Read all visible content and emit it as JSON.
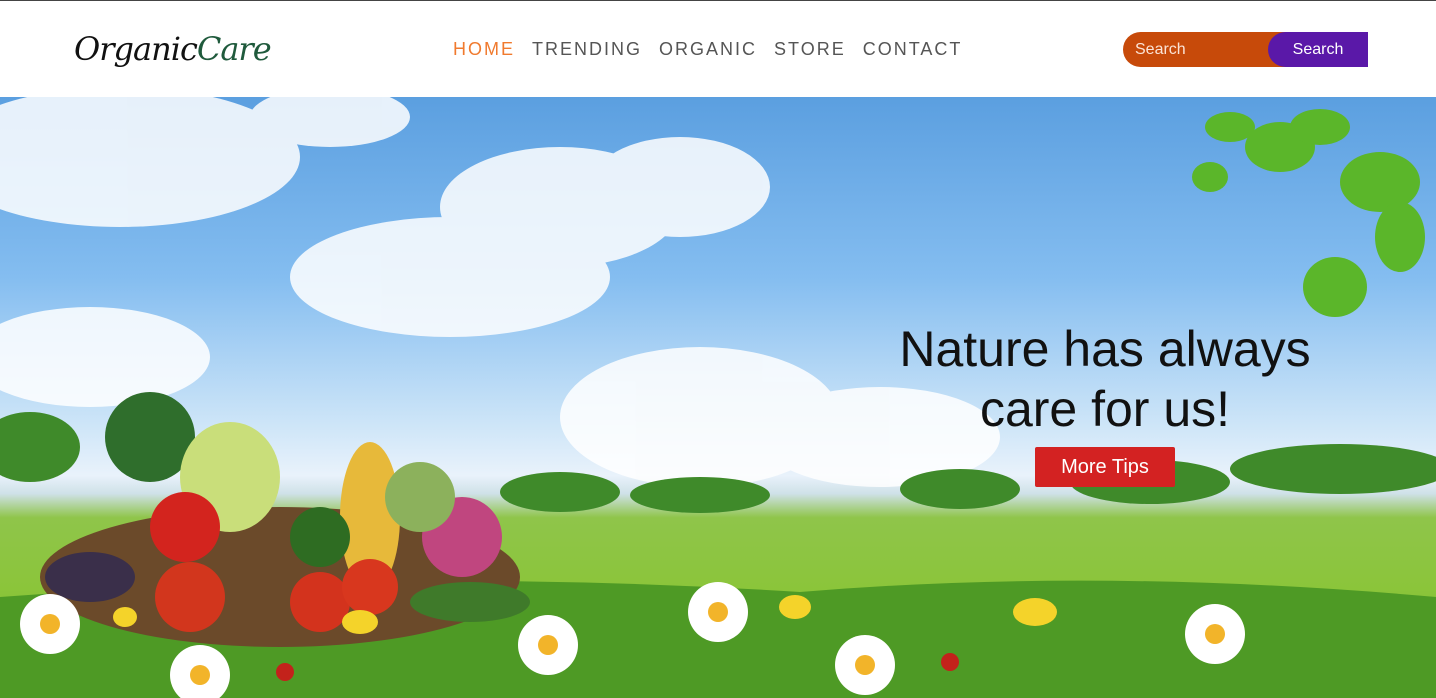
{
  "logo": {
    "part1": "Organic",
    "part2": "Care"
  },
  "nav": {
    "items": [
      {
        "label": "HOME",
        "active": true
      },
      {
        "label": "TRENDING"
      },
      {
        "label": "ORGANIC"
      },
      {
        "label": "STORE"
      },
      {
        "label": "CONTACT"
      }
    ]
  },
  "search": {
    "placeholder": "Search",
    "button_label": "Search"
  },
  "hero": {
    "headline_line1": "Nature has always",
    "headline_line2": "care for us!",
    "button_label": "More Tips"
  },
  "colors": {
    "accent": "#f07a2e",
    "search_bg": "#c74a0a",
    "search_button": "#5a18a8",
    "cta": "#d32222"
  }
}
